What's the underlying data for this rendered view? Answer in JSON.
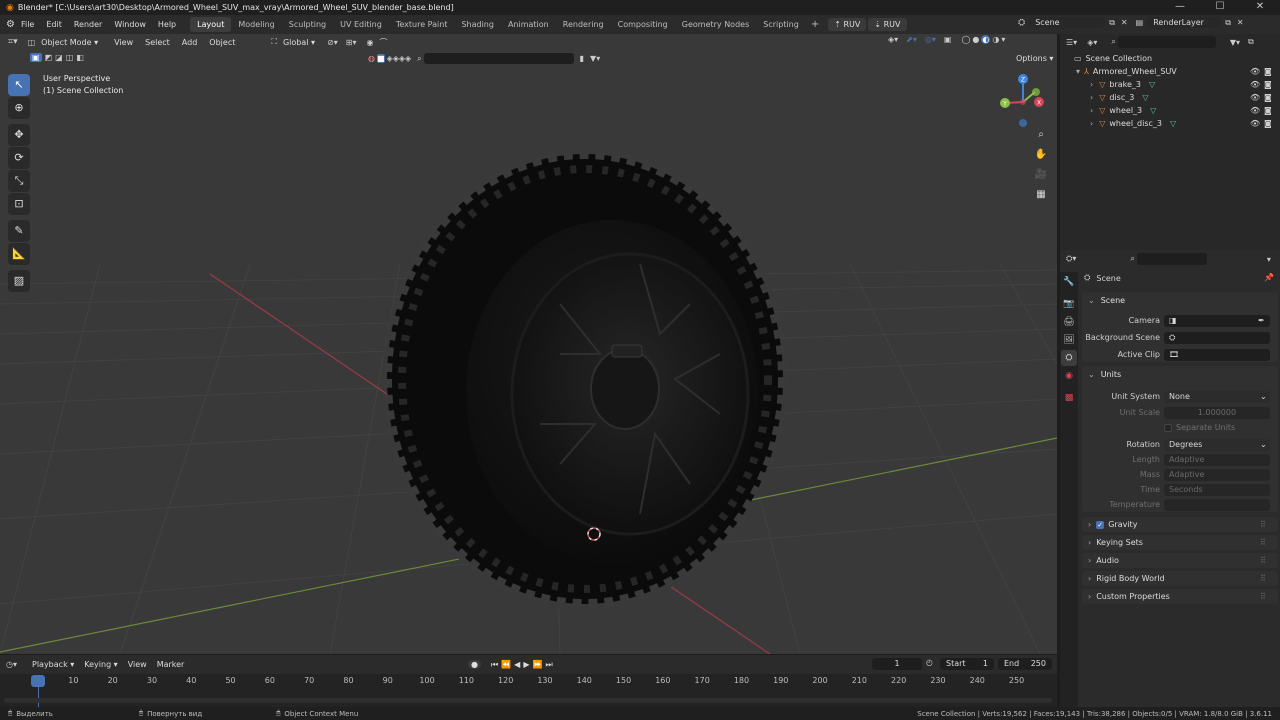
{
  "window": {
    "title": "Blender* [C:\\Users\\art30\\Desktop\\Armored_Wheel_SUV_max_vray\\Armored_Wheel_SUV_blender_base.blend]",
    "controls": [
      "—",
      "☐",
      "✕"
    ]
  },
  "menu": [
    "File",
    "Edit",
    "Render",
    "Window",
    "Help"
  ],
  "workspaces": [
    "Layout",
    "Modeling",
    "Sculpting",
    "UV Editing",
    "Texture Paint",
    "Shading",
    "Animation",
    "Rendering",
    "Compositing",
    "Geometry Nodes",
    "Scripting"
  ],
  "active_workspace": "Layout",
  "addon_buttons": [
    "RUV",
    "RUV"
  ],
  "scene_selector": "Scene",
  "view_layer_selector": "RenderLayer",
  "viewport": {
    "mode": "Object Mode",
    "menus": [
      "View",
      "Select",
      "Add",
      "Object"
    ],
    "orientation": "Global",
    "options_label": "Options",
    "overlay_title": "User Perspective",
    "overlay_subtitle": "(1) Scene Collection",
    "gizmo_axes": [
      "X",
      "Y",
      "Z"
    ]
  },
  "outliner": {
    "root": "Scene Collection",
    "collection": "Armored_Wheel_SUV",
    "items": [
      "brake_3",
      "disc_3",
      "wheel_3",
      "wheel_disc_3"
    ]
  },
  "properties": {
    "context": "Scene",
    "scene_panel": {
      "title": "Scene",
      "camera_label": "Camera",
      "background_label": "Background Scene",
      "clip_label": "Active Clip"
    },
    "units_panel": {
      "title": "Units",
      "unit_system_label": "Unit System",
      "unit_system_value": "None",
      "unit_scale_label": "Unit Scale",
      "unit_scale_value": "1.000000",
      "separate_units_label": "Separate Units",
      "rotation_label": "Rotation",
      "rotation_value": "Degrees",
      "length_label": "Length",
      "length_value": "Adaptive",
      "mass_label": "Mass",
      "mass_value": "Adaptive",
      "time_label": "Time",
      "time_value": "Seconds",
      "temperature_label": "Temperature"
    },
    "subpanels": [
      "Gravity",
      "Keying Sets",
      "Audio",
      "Rigid Body World",
      "Custom Properties"
    ]
  },
  "timeline": {
    "menus": [
      "Playback",
      "Keying",
      "View",
      "Marker"
    ],
    "current_frame": "1",
    "start_label": "Start",
    "start_value": "1",
    "end_label": "End",
    "end_value": "250",
    "ruler": [
      "1",
      "10",
      "20",
      "30",
      "40",
      "50",
      "60",
      "70",
      "80",
      "90",
      "100",
      "110",
      "120",
      "130",
      "140",
      "150",
      "160",
      "170",
      "180",
      "190",
      "200",
      "210",
      "220",
      "230",
      "240",
      "250"
    ]
  },
  "status": {
    "left": "Выделить",
    "middle": "Повернуть вид",
    "context": "Object Context Menu",
    "stats": "Scene Collection | Verts:19,562 | Faces:19,143 | Tris:38,286 | Objects:0/5 | VRAM: 1.8/8.0 GiB | 3.6.11"
  },
  "colors": {
    "accent": "#4772b3",
    "x_axis": "#d9435a",
    "y_axis": "#8ac045",
    "z_axis": "#3f86e0",
    "mesh_icon": "#4cc7b0",
    "object_icon": "#e28a3a"
  }
}
